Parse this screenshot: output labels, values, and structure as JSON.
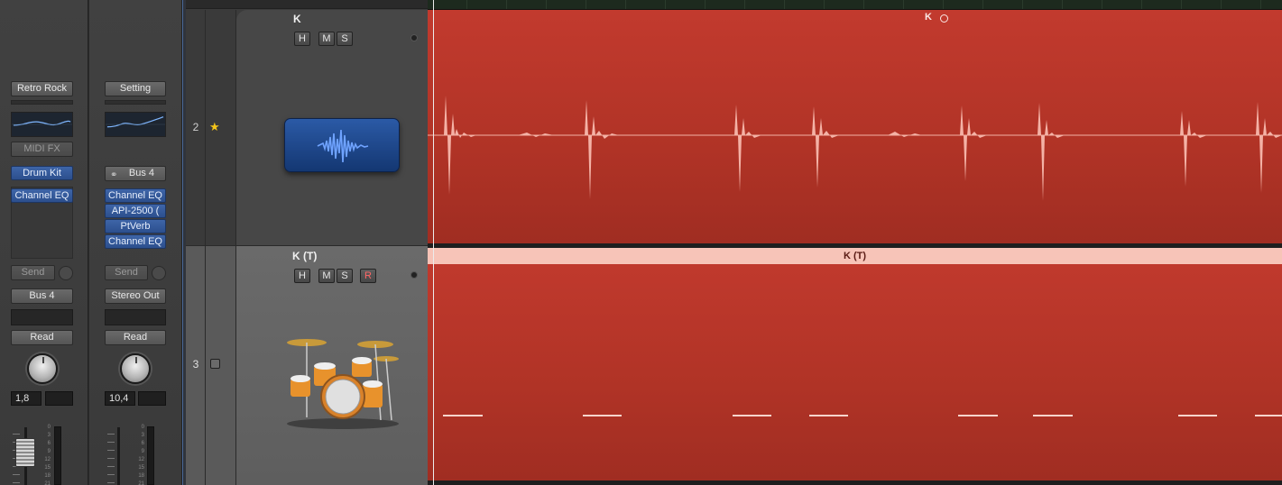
{
  "mixer": {
    "strip1": {
      "setting": "Retro Rock",
      "midi_fx": "MIDI FX",
      "instrument": "Drum Kit",
      "plugins": [
        "Channel EQ"
      ],
      "send": "Send",
      "output": "Bus 4",
      "automation": "Read",
      "pan_value": "1,8"
    },
    "strip2": {
      "setting": "Setting",
      "input": "Bus 4",
      "plugins": [
        "Channel EQ",
        "API-2500 (",
        "PtVerb",
        "Channel EQ"
      ],
      "send": "Send",
      "output": "Stereo Out",
      "automation": "Read",
      "pan_value": "10,4"
    },
    "meter_scale": [
      "0",
      "3",
      "6",
      "9",
      "12",
      "15",
      "18",
      "21"
    ]
  },
  "tracks": [
    {
      "number": "2",
      "name": "K",
      "buttons": [
        "H",
        "M",
        "S"
      ],
      "favorite": true,
      "icon": "audio-waveform-icon"
    },
    {
      "number": "3",
      "name": "K (T)",
      "buttons": [
        "H",
        "M",
        "S",
        "R"
      ],
      "favorite": false,
      "icon": "drum-kit-icon"
    }
  ],
  "regions": [
    {
      "name": "K",
      "looped": true,
      "color": "#c23a2e"
    },
    {
      "name": "K (T)",
      "color": "#c23a2e"
    }
  ],
  "colors": {
    "region": "#c23a2e",
    "region_header": "#f7c4b8",
    "plugin": "#2f5596",
    "star": "#f4c51a"
  }
}
